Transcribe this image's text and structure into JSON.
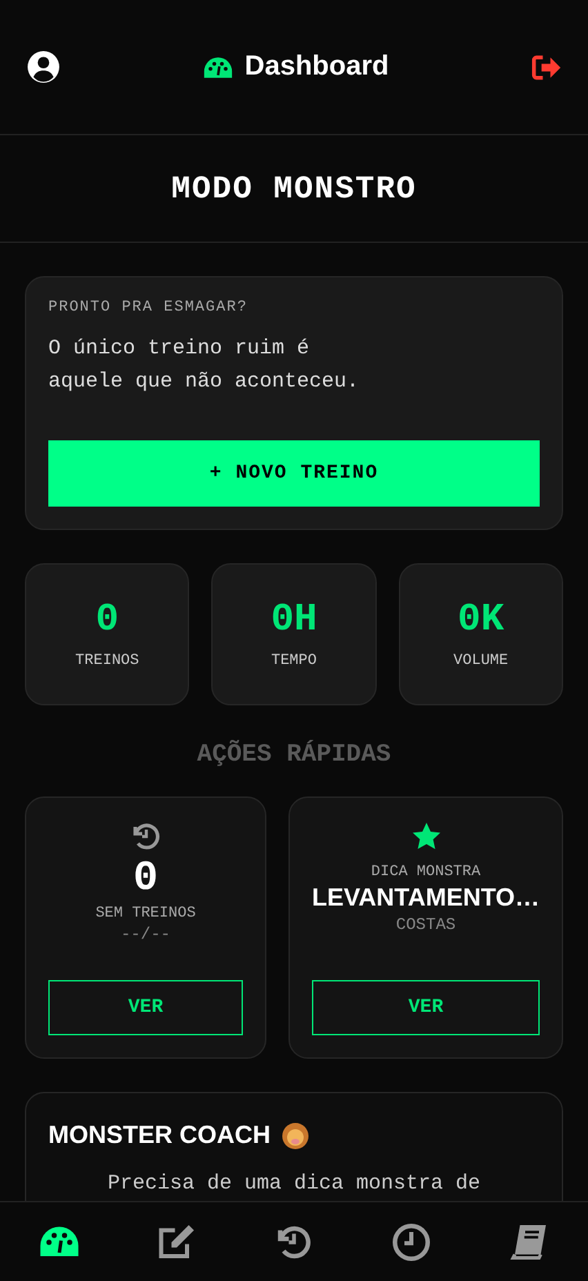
{
  "header": {
    "title": "Dashboard"
  },
  "page_title": "MODO MONSTRO",
  "hero": {
    "eyebrow": "PRONTO PRA ESMAGAR?",
    "quote": "O único treino ruim é aquele que não aconteceu.",
    "button": "+ NOVO TREINO"
  },
  "stats": [
    {
      "value": "0",
      "label": "TREINOS"
    },
    {
      "value": "0H",
      "label": "TEMPO"
    },
    {
      "value": "0K",
      "label": "VOLUME"
    }
  ],
  "section_title": "AÇÕES RÁPIDAS",
  "quick_cards": [
    {
      "kind": "history",
      "value": "0",
      "label": "SEM TREINOS",
      "sub": "--/--",
      "button": "VER"
    },
    {
      "kind": "tip",
      "label": "DICA MONSTRA",
      "value": "LEVANTAMENTO…",
      "sub": "COSTAS",
      "button": "VER"
    }
  ],
  "coach": {
    "title": "MONSTER COACH",
    "text": "Precisa de uma dica monstra de"
  },
  "nav": [
    {
      "kind": "dashboard",
      "selected": true
    },
    {
      "kind": "edit",
      "selected": false
    },
    {
      "kind": "history",
      "selected": false
    },
    {
      "kind": "clock",
      "selected": false
    },
    {
      "kind": "book",
      "selected": false
    }
  ]
}
